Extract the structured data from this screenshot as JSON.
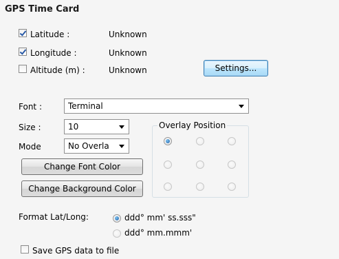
{
  "title": "GPS Time Card",
  "fields": [
    {
      "label": "Latitude :",
      "value": "Unknown",
      "checked": true
    },
    {
      "label": "Longitude :",
      "value": "Unknown",
      "checked": true
    },
    {
      "label": "Altitude (m) :",
      "value": "Unknown",
      "checked": false
    }
  ],
  "settings_label": "Settings...",
  "font": {
    "label": "Font :",
    "value": "Terminal"
  },
  "size": {
    "label": "Size :",
    "value": "10"
  },
  "mode": {
    "label": "Mode",
    "value": "No Overla"
  },
  "change_font_color_label": "Change Font Color",
  "change_bg_color_label": "Change Background Color",
  "overlay": {
    "legend": "Overlay Position",
    "selected": "top-left",
    "grid": [
      [
        "top-left",
        "top-center",
        "top-right"
      ],
      [
        "middle-left",
        "middle-center",
        "middle-right"
      ],
      [
        "bottom-left",
        "bottom-center",
        "bottom-right"
      ]
    ]
  },
  "format": {
    "label": "Format Lat/Long:",
    "options": [
      "ddd° mm' ss.sss\"",
      "ddd° mm.mmm'"
    ],
    "selected": 0
  },
  "save_gps": {
    "label": "Save GPS data to file",
    "checked": false
  },
  "colors": {
    "accent": "#2a5aa6",
    "background": "#f5f5f5",
    "group_border": "#d5dfe5"
  }
}
